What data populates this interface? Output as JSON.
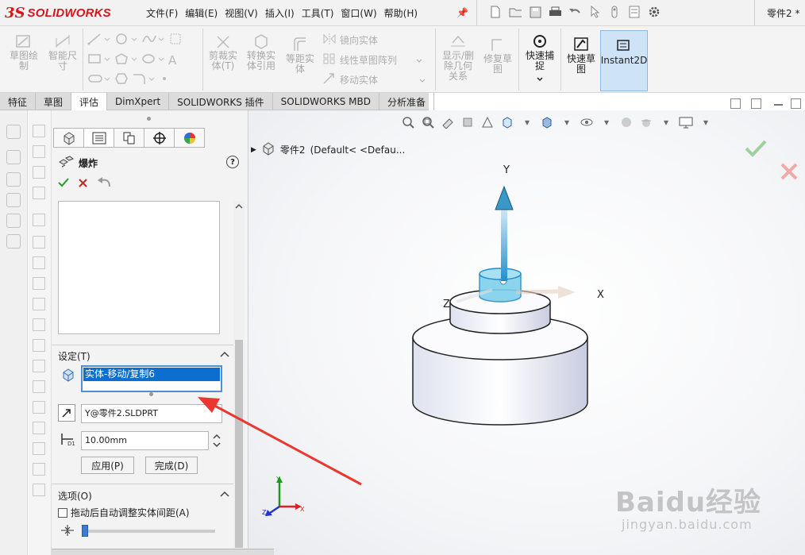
{
  "app": {
    "logo_mark": "3S",
    "logo_text": "SOLIDWORKS",
    "document_title": "零件2 *"
  },
  "menu": [
    "文件(F)",
    "编辑(E)",
    "视图(V)",
    "插入(I)",
    "工具(T)",
    "窗口(W)",
    "帮助(H)"
  ],
  "ribbon": {
    "sketch": "草图绘\n制",
    "smart_dim": "智能尺\n寸",
    "trim": "剪裁实\n体(T)",
    "convert": "转换实\n体引用",
    "offset": "等距实\n体",
    "mirror": "镜向实体",
    "linear_pattern": "线性草图阵列",
    "move": "移动实体",
    "show_delete": "显示/删\n除几何\n关系",
    "repair": "修复草\n图",
    "quick_snap": "快速捕\n捉",
    "rapid_sketch": "快速草\n图",
    "instant2d": "Instant2D"
  },
  "tabs": [
    "特征",
    "草图",
    "评估",
    "DimXpert",
    "SOLIDWORKS 插件",
    "SOLIDWORKS MBD",
    "分析准备"
  ],
  "active_tab": "草图",
  "property_manager": {
    "title": "爆炸",
    "help": "?",
    "settings_title": "设定(T)",
    "selected_body": "实体-移动/复制6",
    "direction": "Y@零件2.SLDPRT",
    "distance": "10.00mm",
    "apply": "应用(P)",
    "done": "完成(D)",
    "options_title": "选项(O)",
    "auto_space": "拖动后自动调整实体间距(A)"
  },
  "tree": {
    "part_name": "零件2",
    "config": "(Default< <Defau..."
  },
  "axes": {
    "y": "Y",
    "x": "X",
    "z": "Z"
  },
  "watermark": {
    "brand": "Baidu经验",
    "url": "jingyan.baidu.com"
  },
  "colors": {
    "accent": "#0c6fd0",
    "ok": "#3a9a3a",
    "cancel": "#cc2222",
    "annotation_arrow": "#e8382f"
  }
}
